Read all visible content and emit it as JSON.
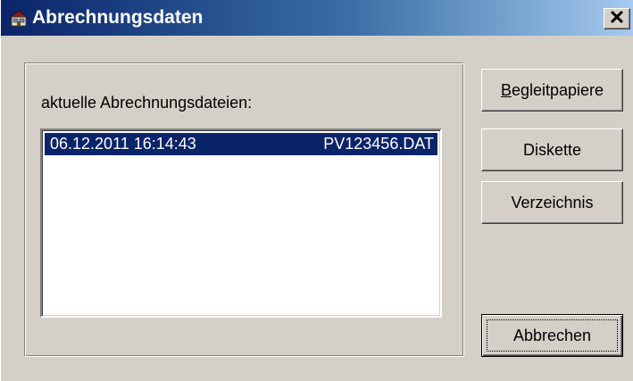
{
  "window": {
    "title": "Abrechnungsdaten",
    "app_icon": "folder-house-icon",
    "close_glyph": "✕"
  },
  "group": {
    "label": "aktuelle Abrechnungsdateien:"
  },
  "files": [
    {
      "date": "06.12.2011 16:14:43",
      "file": "PV123456.DAT",
      "selected": true
    }
  ],
  "buttons": {
    "begleitpapiere_first": "B",
    "begleitpapiere_rest": "egleitpapiere",
    "diskette": "Diskette",
    "verzeichnis": "Verzeichnis",
    "abbrechen": "Abbrechen"
  },
  "colors": {
    "face": "#d4d0c8",
    "selection": "#0a246a",
    "title_start": "#0a246a",
    "title_end": "#a6caf0"
  }
}
